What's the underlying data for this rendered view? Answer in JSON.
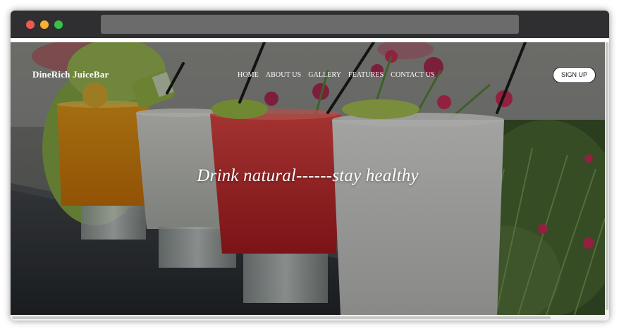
{
  "window": {
    "controls": [
      {
        "name": "close",
        "color": "#f2574f"
      },
      {
        "name": "minimize",
        "color": "#f7b12e"
      },
      {
        "name": "maximize",
        "color": "#35c14a"
      }
    ],
    "address_text": ""
  },
  "page": {
    "brand": "DineRich JuiceBar",
    "nav": [
      "HOME",
      "ABOUT US",
      "GALLERY",
      "FEATURES",
      "CONTACT US"
    ],
    "signup_label": "SIGN UP",
    "tagline": "Drink natural------stay healthy",
    "hero_image": "juice-glasses-photo"
  }
}
